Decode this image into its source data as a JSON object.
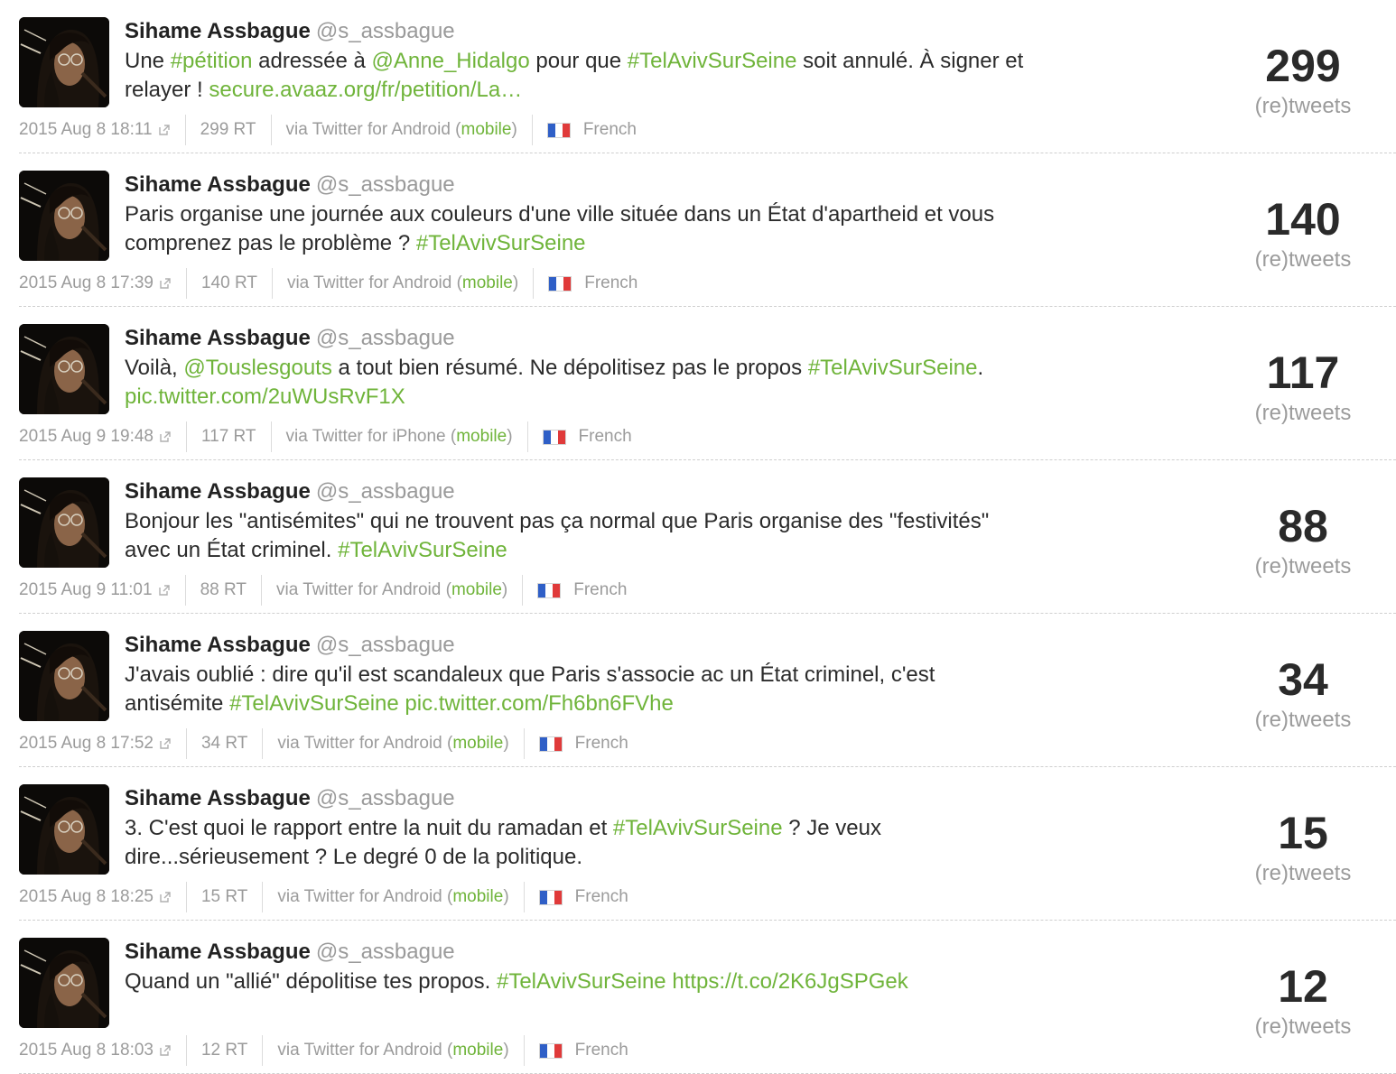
{
  "colors": {
    "link": "#6fb43a",
    "muted": "#9b9b9b",
    "text": "#2b2b2b",
    "name": "#222222"
  },
  "tweets": [
    {
      "author": "Sihame Assbague",
      "handle": "@s_assbague",
      "text_parts": [
        {
          "t": "Une "
        },
        {
          "t": "#pétition",
          "link": true
        },
        {
          "t": " adressée à "
        },
        {
          "t": "@Anne_Hidalgo",
          "link": true
        },
        {
          "t": " pour que "
        },
        {
          "t": "#TelAvivSurSeine",
          "link": true
        },
        {
          "t": " soit annulé. À signer et relayer ! "
        },
        {
          "t": "secure.avaaz.org/fr/petition/La…",
          "link": true
        }
      ],
      "date": "2015 Aug 8 18:11",
      "rt": "299 RT",
      "via_prefix": "via Twitter for Android (",
      "via_link": "mobile",
      "via_suffix": ")",
      "language": "French",
      "count": "299",
      "count_label": "(re)tweets"
    },
    {
      "author": "Sihame Assbague",
      "handle": "@s_assbague",
      "text_parts": [
        {
          "t": "Paris organise une journée aux couleurs d'une ville située dans un État d'apartheid et vous comprenez pas le problème ? "
        },
        {
          "t": "#TelAvivSurSeine",
          "link": true
        }
      ],
      "date": "2015 Aug 8 17:39",
      "rt": "140 RT",
      "via_prefix": "via Twitter for Android (",
      "via_link": "mobile",
      "via_suffix": ")",
      "language": "French",
      "count": "140",
      "count_label": "(re)tweets"
    },
    {
      "author": "Sihame Assbague",
      "handle": "@s_assbague",
      "text_parts": [
        {
          "t": "Voilà, "
        },
        {
          "t": "@Touslesgouts",
          "link": true
        },
        {
          "t": " a tout bien résumé. Ne dépolitisez pas le propos "
        },
        {
          "t": "#TelAvivSurSeine",
          "link": true
        },
        {
          "t": ". "
        },
        {
          "t": "pic.twitter.com/2uWUsRvF1X",
          "link": true
        }
      ],
      "date": "2015 Aug 9 19:48",
      "rt": "117 RT",
      "via_prefix": "via Twitter for iPhone (",
      "via_link": "mobile",
      "via_suffix": ")",
      "language": "French",
      "count": "117",
      "count_label": "(re)tweets"
    },
    {
      "author": "Sihame Assbague",
      "handle": "@s_assbague",
      "text_parts": [
        {
          "t": "Bonjour les \"antisémites\" qui ne trouvent pas ça normal que Paris organise des \"festivités\" avec un État criminel. "
        },
        {
          "t": "#TelAvivSurSeine",
          "link": true
        }
      ],
      "date": "2015 Aug 9 11:01",
      "rt": "88 RT",
      "via_prefix": "via Twitter for Android (",
      "via_link": "mobile",
      "via_suffix": ")",
      "language": "French",
      "count": "88",
      "count_label": "(re)tweets"
    },
    {
      "author": "Sihame Assbague",
      "handle": "@s_assbague",
      "text_parts": [
        {
          "t": "J'avais oublié : dire qu'il est scandaleux que Paris s'associe ac un État criminel, c'est antisémite "
        },
        {
          "t": "#TelAvivSurSeine",
          "link": true
        },
        {
          "t": " "
        },
        {
          "t": "pic.twitter.com/Fh6bn6FVhe",
          "link": true
        }
      ],
      "date": "2015 Aug 8 17:52",
      "rt": "34 RT",
      "via_prefix": "via Twitter for Android (",
      "via_link": "mobile",
      "via_suffix": ")",
      "language": "French",
      "count": "34",
      "count_label": "(re)tweets"
    },
    {
      "author": "Sihame Assbague",
      "handle": "@s_assbague",
      "text_parts": [
        {
          "t": "3. C'est quoi le rapport entre la nuit du ramadan et "
        },
        {
          "t": "#TelAvivSurSeine",
          "link": true
        },
        {
          "t": " ? Je veux dire...sérieusement ? Le degré 0 de la politique."
        }
      ],
      "date": "2015 Aug 8 18:25",
      "rt": "15 RT",
      "via_prefix": "via Twitter for Android (",
      "via_link": "mobile",
      "via_suffix": ")",
      "language": "French",
      "count": "15",
      "count_label": "(re)tweets"
    },
    {
      "author": "Sihame Assbague",
      "handle": "@s_assbague",
      "text_parts": [
        {
          "t": "Quand un \"allié\" dépolitise tes propos. "
        },
        {
          "t": "#TelAvivSurSeine",
          "link": true
        },
        {
          "t": " "
        },
        {
          "t": "https://t.co/2K6JgSPGek",
          "link": true
        }
      ],
      "date": "2015 Aug 8 18:03",
      "rt": "12 RT",
      "via_prefix": "via Twitter for Android (",
      "via_link": "mobile",
      "via_suffix": ")",
      "language": "French",
      "count": "12",
      "count_label": "(re)tweets"
    }
  ]
}
